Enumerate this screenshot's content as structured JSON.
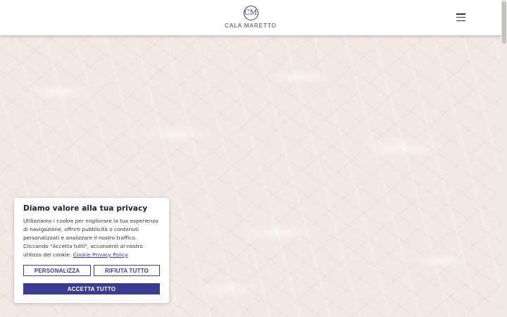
{
  "header": {
    "logo_mark": "CM",
    "logo_text": "CALA MARETTO"
  },
  "cookie_banner": {
    "title": "Diamo valore alla tua privacy",
    "body": "Utilizziamo i cookie per migliorare la tua esperienza di navigazione, offrirti pubblicità o contenuti personalizzati e analizzare il nostro traffico. Cliccando \"Accetta tutti\", acconsenti al nostro utilizzo dei cookie.",
    "policy_link": "Cookie Privacy Policy",
    "customize_label": "PERSONALIZZA",
    "reject_label": "RIFIUTA TUTTO",
    "accept_label": "ACCETTA TUTTO"
  },
  "colors": {
    "brand": "#3b3b8f",
    "logo": "#3d3f6e",
    "hero_bg": "#f1e9e4"
  },
  "icons": {
    "menu": "hamburger-icon",
    "logo": "logo-icon"
  }
}
